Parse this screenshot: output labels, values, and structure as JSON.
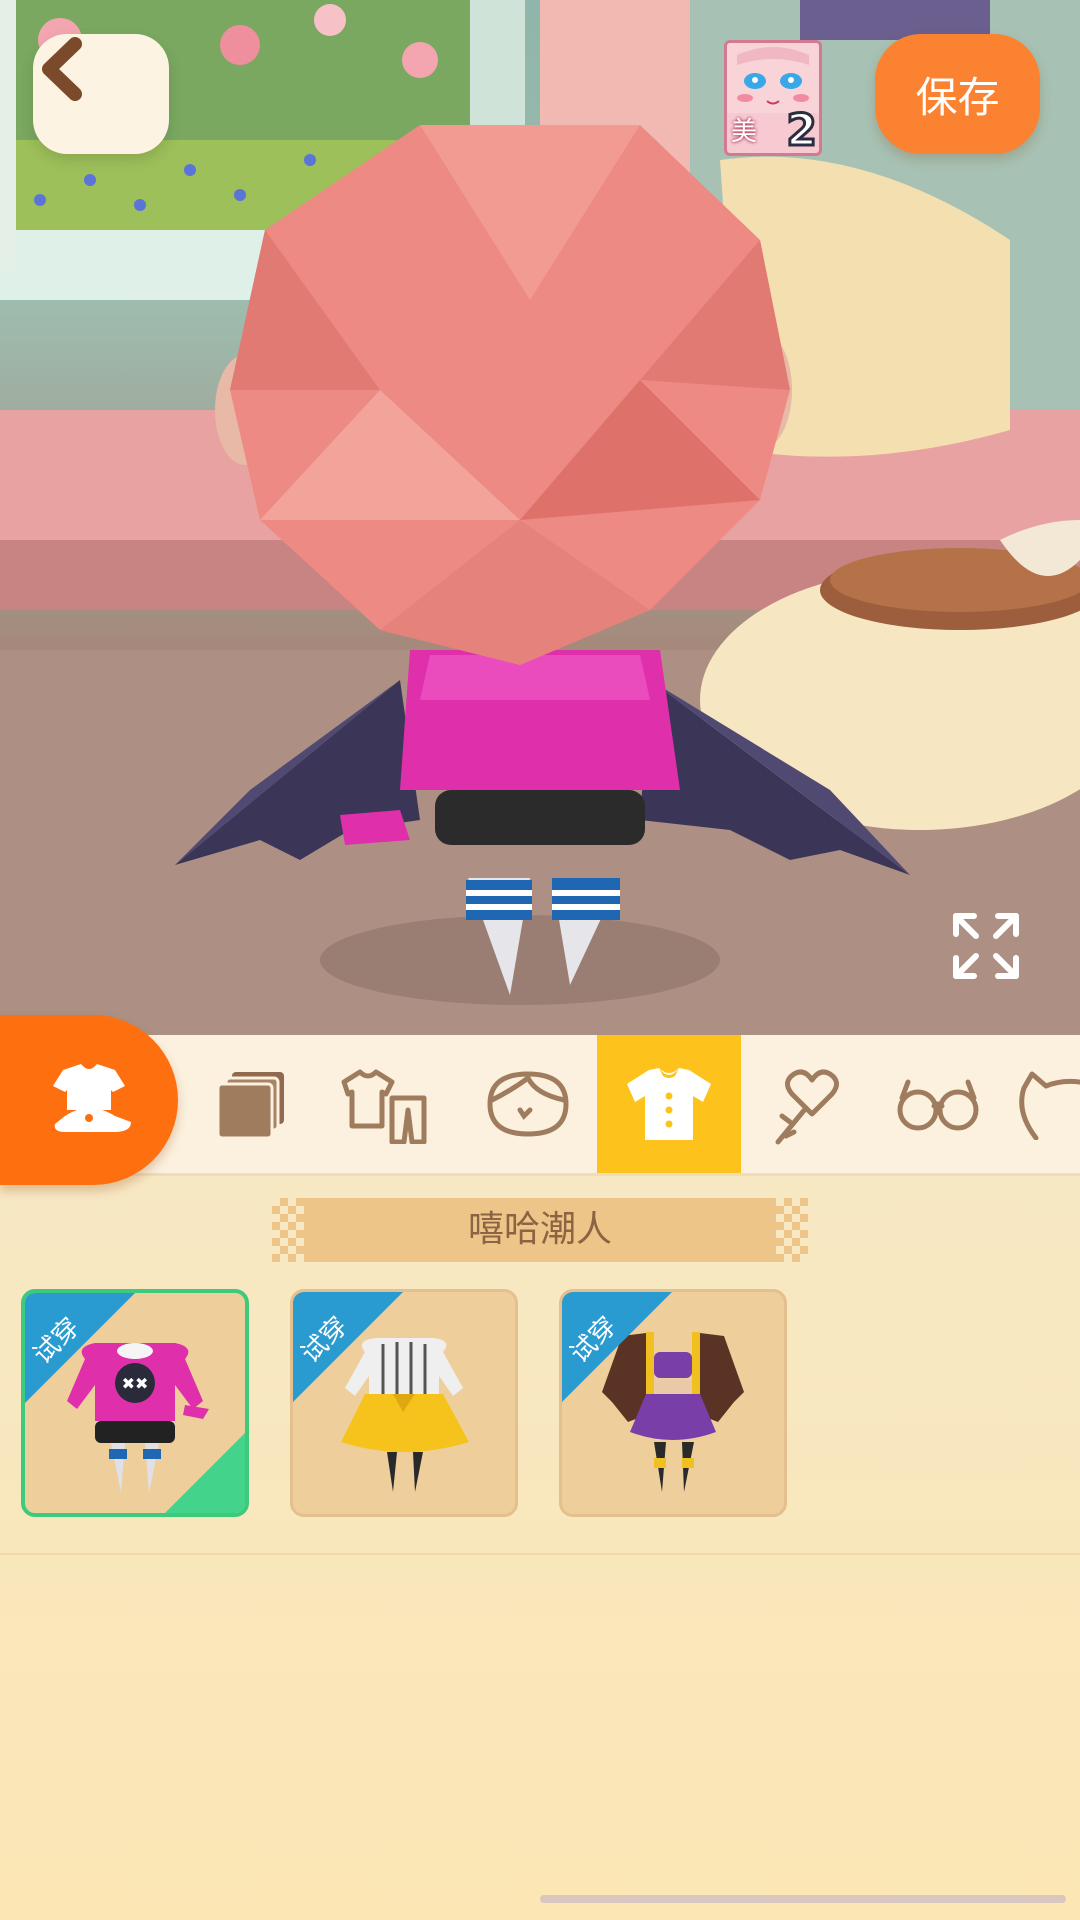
{
  "header": {
    "back_icon": "chevron-left-icon",
    "avatar_badge": {
      "label": "美",
      "count": "2"
    },
    "save_label": "保存"
  },
  "scene": {
    "character": "pink-haired chibi avatar with bat wings, pink sweater, black shorts, striped socks",
    "expand_icon": "expand-arrows-icon"
  },
  "categories": {
    "main_icon": "outfit-icon",
    "tabs": [
      {
        "icon": "layers-icon",
        "active": false
      },
      {
        "icon": "clothing-set-icon",
        "active": false
      },
      {
        "icon": "face-icon",
        "active": false
      },
      {
        "icon": "shirt-icon",
        "active": true
      },
      {
        "icon": "heart-wand-icon",
        "active": false
      },
      {
        "icon": "glasses-icon",
        "active": false
      },
      {
        "icon": "cat-ears-icon",
        "active": false
      }
    ]
  },
  "collection": {
    "title": "嘻哈潮人"
  },
  "items": [
    {
      "tag": "试穿",
      "outfit": "pink-hoodie-outfit",
      "selected": true
    },
    {
      "tag": "试穿",
      "outfit": "yellow-skirt-outfit",
      "selected": false
    },
    {
      "tag": "试穿",
      "outfit": "purple-jacket-outfit",
      "selected": false
    }
  ],
  "colors": {
    "accent": "#fd6f0f",
    "active_tab": "#fdc31c",
    "save": "#fb8230",
    "selected_border": "#3dca7c",
    "tag": "#2a9bd0"
  }
}
